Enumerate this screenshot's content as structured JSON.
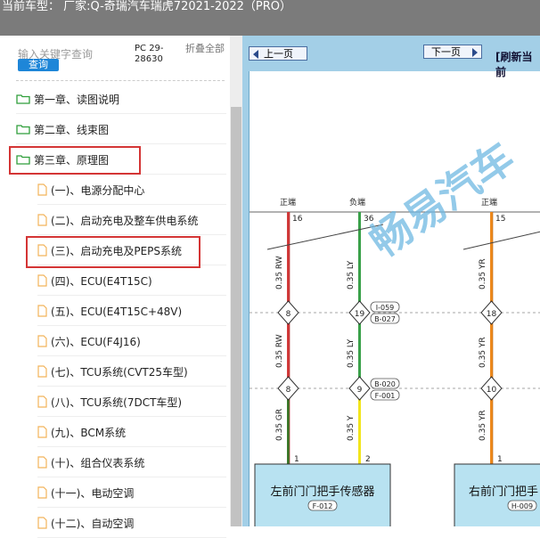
{
  "header": {
    "title": "当前车型： 厂家:Q-奇瑞汽车瑞虎72021-2022（PRO）"
  },
  "search": {
    "placeholder": "输入关键字查询",
    "button_label": "查询"
  },
  "pc_label": "PC 29-28630",
  "collapse_label": "折叠全部",
  "tree": {
    "chapters": [
      {
        "label": "第一章、读图说明"
      },
      {
        "label": "第二章、线束图"
      },
      {
        "label": "第三章、原理图"
      }
    ],
    "items": [
      {
        "label": "(一)、电源分配中心"
      },
      {
        "label": "(二)、启动充电及整车供电系统"
      },
      {
        "label": "(三)、启动充电及PEPS系统"
      },
      {
        "label": "(四)、ECU(E4T15C)"
      },
      {
        "label": "(五)、ECU(E4T15C+48V)"
      },
      {
        "label": "(六)、ECU(F4J16)"
      },
      {
        "label": "(七)、TCU系统(CVT25车型)"
      },
      {
        "label": "(八)、TCU系统(7DCT车型)"
      },
      {
        "label": "(九)、BCM系统"
      },
      {
        "label": "(十)、组合仪表系统"
      },
      {
        "label": "(十一)、电动空调"
      },
      {
        "label": "(十二)、自动空调"
      }
    ]
  },
  "diagram": {
    "prev_page": "上一页",
    "next_page": "下一页",
    "refresh": "[刷新当前",
    "watermark": "畅易汽车",
    "ground_labels": [
      "正端",
      "负端",
      "正端"
    ],
    "pin_numbers_top": [
      "16",
      "36",
      "15"
    ],
    "wire_labels": [
      "0.35 RW",
      "0.35 LY",
      "0.35 YR",
      "0.35 RW",
      "0.35 LY",
      "0.35 YR",
      "0.35 GR",
      "0.35 Y",
      "0.35 YR"
    ],
    "splice_numbers": [
      "8",
      "19",
      "18",
      "8",
      "9",
      "10"
    ],
    "connector_refs": [
      "I-059",
      "B-027",
      "B-020",
      "F-001"
    ],
    "pin_numbers_bottom": [
      "1",
      "2",
      "1"
    ],
    "component_left": {
      "name": "左前门门把手传感器",
      "code": "F-012"
    },
    "component_right": {
      "name": "右前门门把手",
      "code": "H-009"
    }
  },
  "colors": {
    "folder": "#2f9e3a",
    "doc": "#f2b35a",
    "highlight": "#d43535",
    "accent": "#1e86d8",
    "wire_red": "#d23b3b",
    "wire_green": "#3aa14a",
    "wire_orange": "#ef8a1c",
    "wire_yellow": "#f2e51d"
  }
}
